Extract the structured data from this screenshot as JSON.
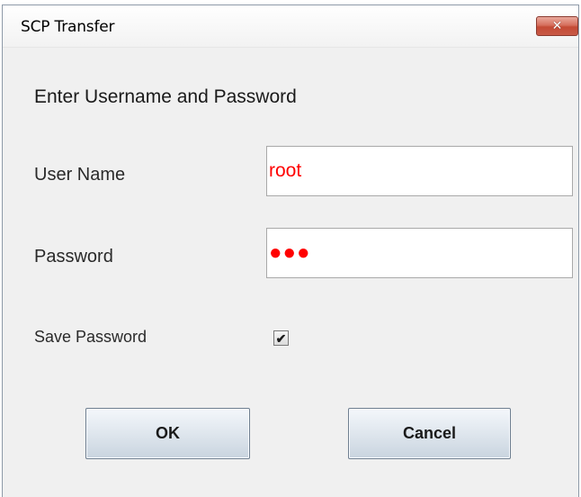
{
  "window": {
    "title": "SCP Transfer",
    "close_glyph": "✕"
  },
  "form": {
    "heading": "Enter Username and Password",
    "username_label": "User Name",
    "username_value": "root",
    "password_label": "Password",
    "password_display": "●●●",
    "save_password_label": "Save Password",
    "save_password_checked": true,
    "check_glyph": "✔"
  },
  "buttons": {
    "ok_label": "OK",
    "cancel_label": "Cancel"
  },
  "colors": {
    "input_text": "#ff0000",
    "close_button": "#c44a35",
    "dialog_bg": "#f0f0f0"
  },
  "icons": {
    "close": "close-icon",
    "check": "check-icon"
  }
}
